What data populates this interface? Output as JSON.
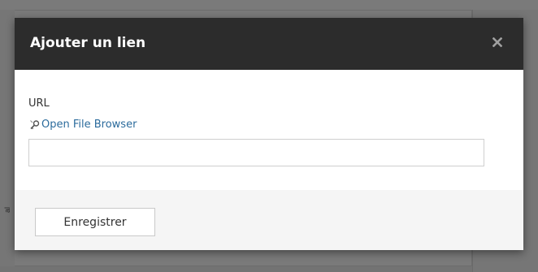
{
  "modal": {
    "title": "Ajouter un lien",
    "close_icon": "close-icon",
    "url_label": "URL",
    "file_browser_label": "Open File Browser",
    "file_browser_icon": "magnifier-key-icon",
    "url_value": "",
    "save_label": "Enregistrer"
  },
  "background": {
    "fragment_text": "al"
  },
  "colors": {
    "header_bg": "#2c2c2c",
    "link": "#2b6b9c",
    "footer_bg": "#f5f5f5"
  }
}
